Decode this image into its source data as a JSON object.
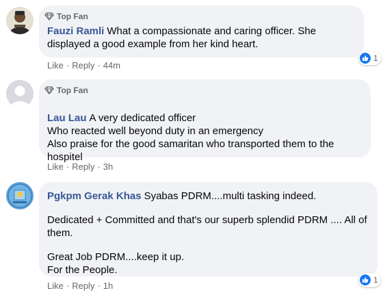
{
  "comments": [
    {
      "badge": "Top Fan",
      "author": "Fauzi Ramli",
      "paragraphs": [
        "What a compassionate and caring officer. She displayed a good example from her kind heart."
      ],
      "actions": {
        "like": "Like",
        "reply": "Reply",
        "time": "44m"
      },
      "reaction_count": "1"
    },
    {
      "badge": "Top Fan",
      "author": "Lau Lau",
      "paragraphs": [
        "A very dedicated officer\nWho reacted well beyond duty in an emergency\nAlso praise for the good samaritan who transported them to the hospitel"
      ],
      "actions": {
        "like": "Like",
        "reply": "Reply",
        "time": "3h"
      }
    },
    {
      "author": "Pgkpm Gerak Khas",
      "paragraphs": [
        "Syabas PDRM....multi tasking indeed.",
        "Dedicated + Committed and that's our superb splendid PDRM .... All of them.",
        "Great Job PDRM....keep it up.\nFor the People."
      ],
      "actions": {
        "like": "Like",
        "reply": "Reply",
        "time": "1h"
      },
      "reaction_count": "1"
    }
  ],
  "colors": {
    "bubble": "#f0f2f5",
    "author": "#385898",
    "meta": "#65676b",
    "like": "#1877f2"
  },
  "icons": [
    "diamond-icon",
    "like-thumb-icon",
    "default-avatar-icon"
  ]
}
